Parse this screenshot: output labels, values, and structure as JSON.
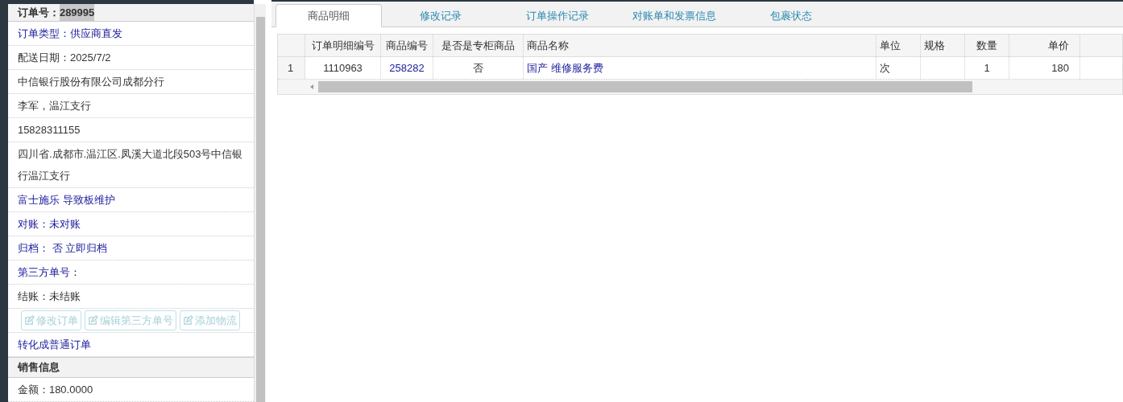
{
  "order": {
    "label": "订单号：",
    "number": "289995"
  },
  "rows": [
    {
      "kind": "link",
      "text": "订单类型：供应商直发"
    },
    {
      "kind": "text",
      "text": "配送日期：2025/7/2"
    },
    {
      "kind": "text",
      "text": "中信银行股份有限公司成都分行"
    },
    {
      "kind": "text",
      "text": "李军，温江支行"
    },
    {
      "kind": "text",
      "text": "15828311155"
    },
    {
      "kind": "text",
      "text": "四川省.成都市.温江区.凤溪大道北段503号中信银行温江支行"
    },
    {
      "kind": "link",
      "text": "富士施乐 导致板维护"
    },
    {
      "kind": "link",
      "text": "对账：未对账"
    },
    {
      "kind": "link",
      "text": "归档：  否 立即归档"
    },
    {
      "kind": "link",
      "text": "第三方单号："
    },
    {
      "kind": "text",
      "text": "结账：未结账"
    },
    {
      "kind": "buttons",
      "buttons": [
        {
          "label": "修改订单",
          "disabled": true
        },
        {
          "label": "编辑第三方单号",
          "disabled": true
        },
        {
          "label": "添加物流",
          "disabled": true
        }
      ]
    },
    {
      "kind": "link",
      "text": "转化成普通订单"
    },
    {
      "kind": "section",
      "text": "销售信息"
    },
    {
      "kind": "text",
      "text": "金额：180.0000"
    }
  ],
  "tabs": [
    {
      "label": "商品明细",
      "selected": true
    },
    {
      "label": "修改记录",
      "selected": false
    },
    {
      "label": "订单操作记录",
      "selected": false
    },
    {
      "label": "对账单和发票信息",
      "selected": false
    },
    {
      "label": "包裹状态",
      "selected": false
    }
  ],
  "table": {
    "columns": [
      {
        "label": "订单明细编号"
      },
      {
        "label": "商品编号"
      },
      {
        "label": "是否是专柜商品"
      },
      {
        "label": "商品名称"
      },
      {
        "label": "单位"
      },
      {
        "label": "规格"
      },
      {
        "label": "数量"
      },
      {
        "label": "单价"
      }
    ],
    "rows": [
      {
        "index": "1",
        "cells": [
          {
            "text": "1110963",
            "link": false
          },
          {
            "text": "258282",
            "link": true
          },
          {
            "text": "否",
            "link": false
          },
          {
            "text": "国产 维修服务费",
            "link": true
          },
          {
            "text": "次",
            "link": false
          },
          {},
          {
            "text": "1",
            "link": false
          },
          {
            "text": "180",
            "link": false
          }
        ]
      }
    ]
  }
}
